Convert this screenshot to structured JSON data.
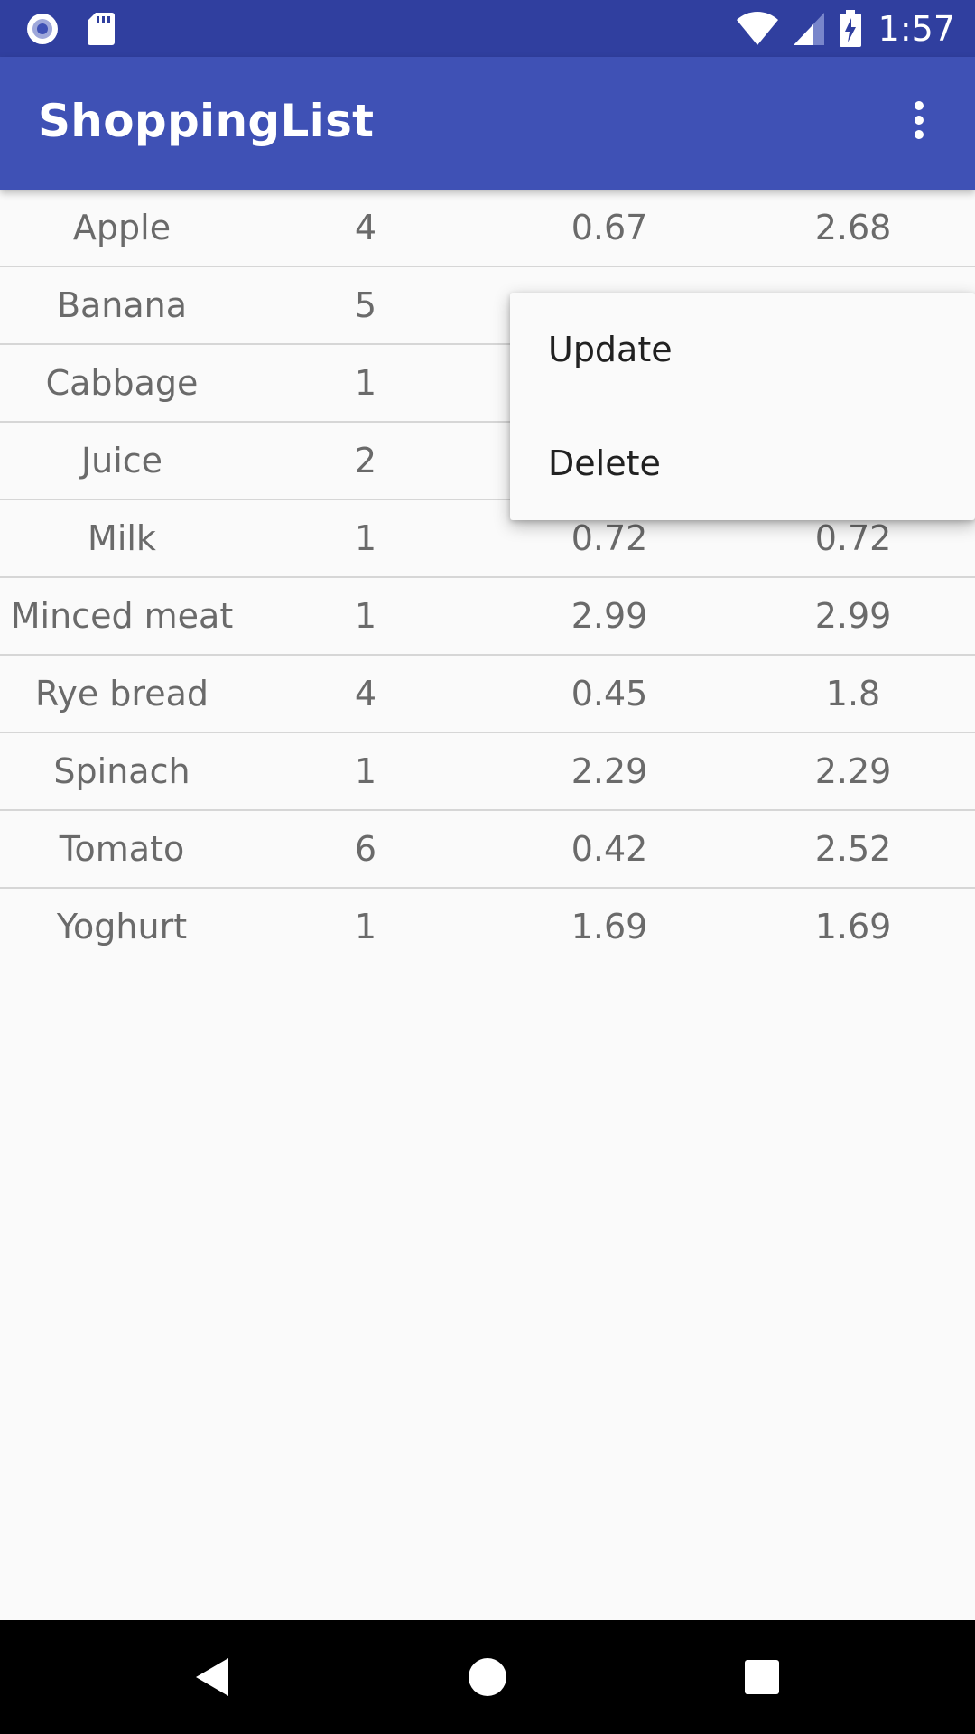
{
  "status_bar": {
    "time": "1:57",
    "left_icons": [
      "record-icon",
      "sd-card-icon"
    ],
    "right_icons": [
      "wifi-icon",
      "signal-icon",
      "battery-charging-icon"
    ],
    "background": "#303f9f"
  },
  "app_bar": {
    "title": "ShoppingList",
    "background": "#3f51b5",
    "overflow_icon": "more-vert-icon"
  },
  "list": {
    "rows": [
      {
        "name": "Apple",
        "quantity": "4",
        "price": "0.67",
        "total": "2.68"
      },
      {
        "name": "Banana",
        "quantity": "5",
        "price": "",
        "total": ""
      },
      {
        "name": "Cabbage",
        "quantity": "1",
        "price": "",
        "total": ""
      },
      {
        "name": "Juice",
        "quantity": "2",
        "price": "",
        "total": ""
      },
      {
        "name": "Milk",
        "quantity": "1",
        "price": "0.72",
        "total": "0.72"
      },
      {
        "name": "Minced meat",
        "quantity": "1",
        "price": "2.99",
        "total": "2.99"
      },
      {
        "name": "Rye bread",
        "quantity": "4",
        "price": "0.45",
        "total": "1.8"
      },
      {
        "name": "Spinach",
        "quantity": "1",
        "price": "2.29",
        "total": "2.29"
      },
      {
        "name": "Tomato",
        "quantity": "6",
        "price": "0.42",
        "total": "2.52"
      },
      {
        "name": "Yoghurt",
        "quantity": "1",
        "price": "1.69",
        "total": "1.69"
      }
    ]
  },
  "popup_menu": {
    "items": [
      {
        "label": "Update"
      },
      {
        "label": "Delete"
      }
    ]
  },
  "nav_bar": {
    "icons": [
      "back-icon",
      "home-icon",
      "recents-icon"
    ]
  }
}
